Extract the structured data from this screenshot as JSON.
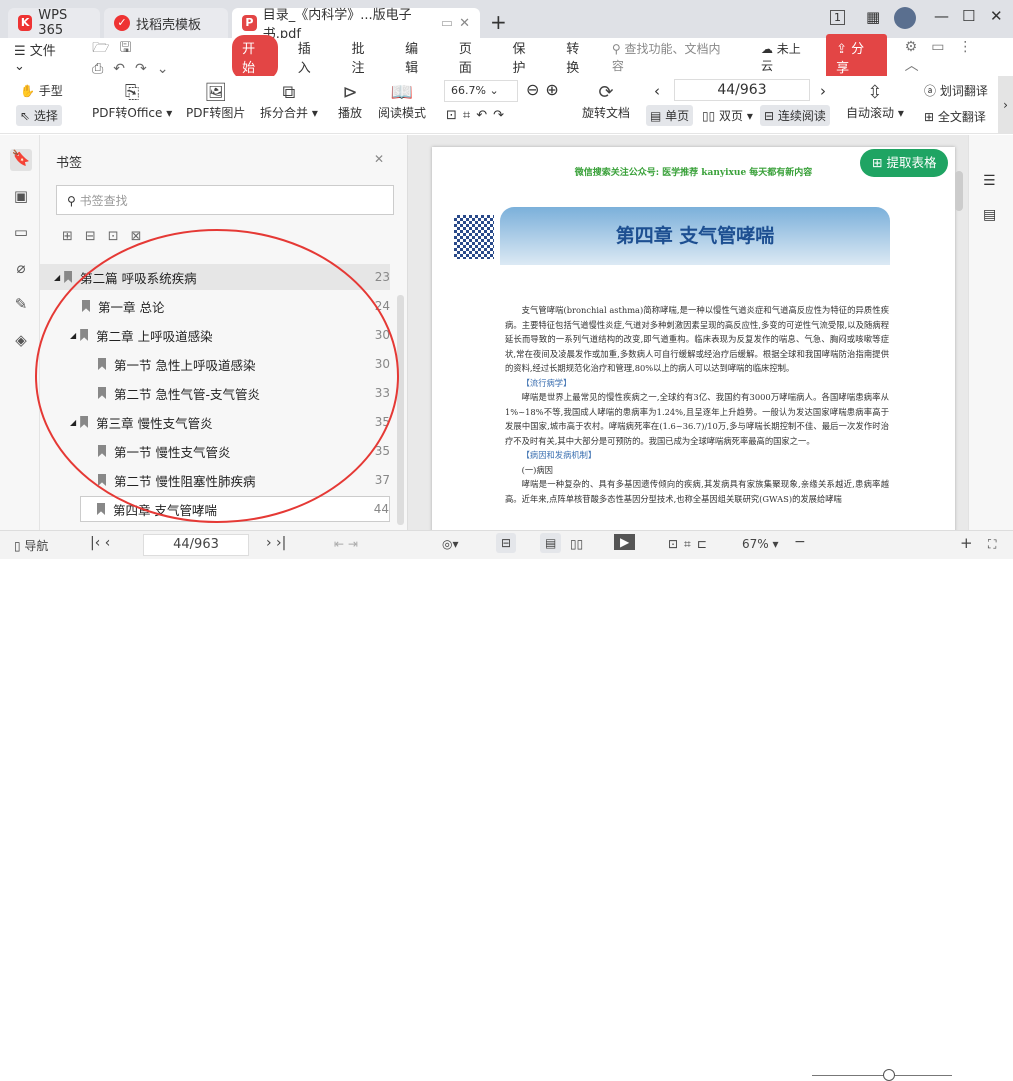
{
  "tabs": [
    {
      "label": "WPS 365"
    },
    {
      "label": "找稻壳模板"
    },
    {
      "label": "目录_《内科学》...版电子书.pdf"
    }
  ],
  "window": {
    "page_indicator": "1"
  },
  "menu": {
    "file": "文件",
    "items": [
      "开始",
      "插入",
      "批注",
      "编辑",
      "页面",
      "保护",
      "转换"
    ],
    "search_placeholder": "查找功能、文档内容",
    "cloud": "未上云",
    "share": "分享"
  },
  "toolbar": {
    "hand": "手型",
    "select": "选择",
    "pdf_office": "PDF转Office",
    "pdf_image": "PDF转图片",
    "split": "拆分合并",
    "play": "播放",
    "read_mode": "阅读模式",
    "zoom": "66.7%",
    "rotate": "旋转文档",
    "page": "44/963",
    "single": "单页",
    "double": "双页",
    "continuous": "连续阅读",
    "autoscroll": "自动滚动",
    "word_translate": "划词翻译",
    "full_translate": "全文翻译"
  },
  "bookmarks": {
    "title": "书签",
    "search_placeholder": "书签查找",
    "items": [
      {
        "label": "第二篇  呼吸系统疾病",
        "page": "23"
      },
      {
        "label": "第一章  总论",
        "page": "24"
      },
      {
        "label": "第二章  上呼吸道感染",
        "page": "30"
      },
      {
        "label": "第一节  急性上呼吸道感染",
        "page": "30"
      },
      {
        "label": "第二节  急性气管-支气管炎",
        "page": "33"
      },
      {
        "label": "第三章  慢性支气管炎",
        "page": "35"
      },
      {
        "label": "第一节  慢性支气管炎",
        "page": "35"
      },
      {
        "label": "第二节  慢性阻塞性肺疾病",
        "page": "37"
      },
      {
        "label": "第四章  支气管哮喘",
        "page": "44"
      }
    ]
  },
  "document": {
    "extract_table": "提取表格",
    "header": "微信搜索关注公众号: 医学推荐 kanyixue 每天都有新内容",
    "chapter": "第四章   支气管哮喘",
    "p1": "支气管哮喘(bronchial asthma)简称哮喘,是一种以慢性气道炎症和气道高反应性为特征的异质性疾病。主要特征包括气道慢性炎症,气道对多种刺激因素呈现的高反应性,多变的可逆性气流受限,以及随病程延长而导致的一系列气道结构的改变,即气道重构。临床表现为反复发作的喘息、气急、胸闷或咳嗽等症状,常在夜间及凌晨发作或加重,多数病人可自行缓解或经治疗后缓解。根据全球和我国哮喘防治指南提供的资料,经过长期规范化治疗和管理,80%以上的病人可以达到哮喘的临床控制。",
    "s1": "【流行病学】",
    "p2": "哮喘是世界上最常见的慢性疾病之一,全球约有3亿、我国约有3000万哮喘病人。各国哮喘患病率从1%~18%不等,我国成人哮喘的患病率为1.24%,且呈逐年上升趋势。一般认为发达国家哮喘患病率高于发展中国家,城市高于农村。哮喘病死率在(1.6~36.7)/10万,多与哮喘长期控制不佳、最后一次发作时治疗不及时有关,其中大部分是可预防的。我国已成为全球哮喘病死率最高的国家之一。",
    "s2": "【病因和发病机制】",
    "s3": "(一)病因",
    "p3": "哮喘是一种复杂的、具有多基因遗传倾向的疾病,其发病具有家族集聚现象,亲缘关系越近,患病率越高。近年来,点阵单核苷酸多态性基因分型技术,也称全基因组关联研究(GWAS)的发展给哮喘"
  },
  "status": {
    "nav": "导航",
    "page": "44/963",
    "zoom": "67%",
    "zoom_fraction": 0.55
  },
  "colors": {
    "accent": "#e34545",
    "green": "#1fa463",
    "annotation": "#e53935"
  }
}
